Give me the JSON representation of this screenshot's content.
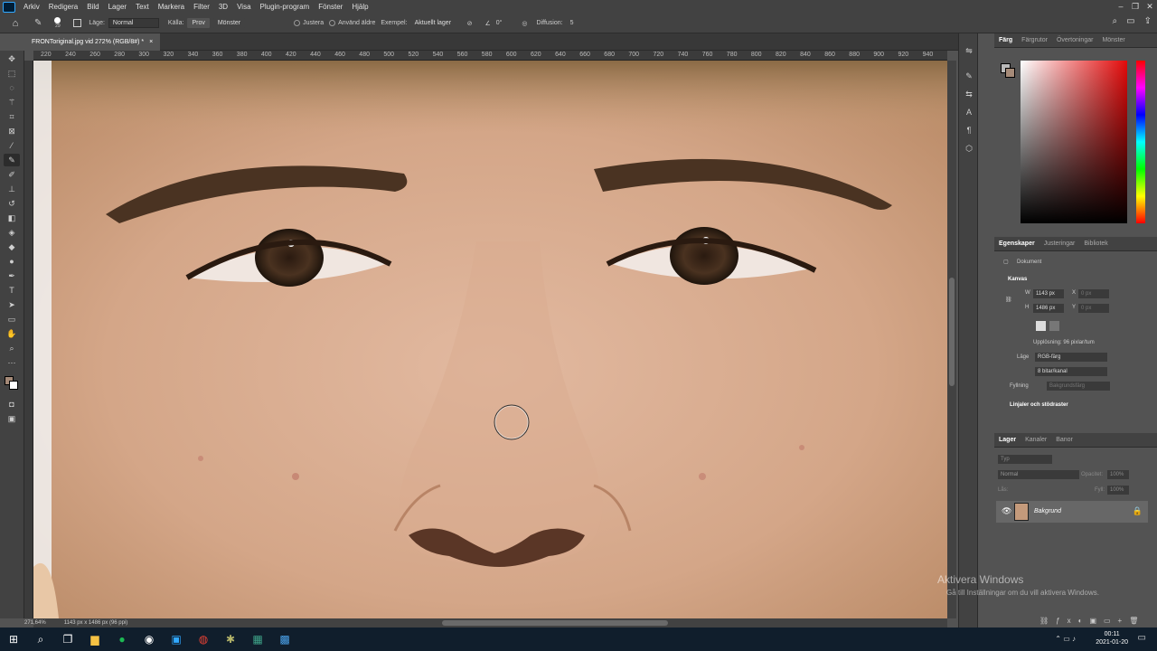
{
  "menu": [
    "Arkiv",
    "Redigera",
    "Bild",
    "Lager",
    "Text",
    "Markera",
    "Filter",
    "3D",
    "Visa",
    "Plugin-program",
    "Fönster",
    "Hjälp"
  ],
  "options": {
    "brush_size": "29",
    "mode_label": "Läge:",
    "mode_value": "Normal",
    "source_label": "Källa:",
    "source_btn1": "Prov",
    "source_btn2": "Mönster",
    "align_label": "Justera",
    "use_old_label": "Använd äldre",
    "sample_label": "Exempel:",
    "sample_value": "Aktuellt lager",
    "angle_value": "0°",
    "diffusion_label": "Diffusion:",
    "diffusion_value": "5"
  },
  "document_tab": {
    "title": "FRONToriginal.jpg vid 272% (RGB/8#) *",
    "close": "×"
  },
  "ruler_ticks": [
    "220",
    "240",
    "260",
    "280",
    "300",
    "320",
    "340",
    "360",
    "380",
    "400",
    "420",
    "440",
    "460",
    "480",
    "500",
    "520",
    "540",
    "560",
    "580",
    "600",
    "620",
    "640",
    "660",
    "680",
    "700",
    "720",
    "740",
    "760",
    "780",
    "800",
    "820",
    "840",
    "860",
    "880",
    "900",
    "920",
    "940"
  ],
  "status": {
    "zoom": "271,64%",
    "size": "1143 px x 1486 px (96 ppi)"
  },
  "color_panel": {
    "tabs": [
      "Färg",
      "Färgrutor",
      "Övertoningar",
      "Mönster"
    ],
    "active": "Färg"
  },
  "properties_panel": {
    "tabs": [
      "Egenskaper",
      "Justeringar",
      "Bibliotek"
    ],
    "doc_label": "Dokument",
    "canvas_section": "Kanvas",
    "w_label": "W",
    "w_value": "1143 px",
    "x_label": "X",
    "x_value": "0 px",
    "h_label": "H",
    "h_value": "1486 px",
    "y_label": "Y",
    "y_value": "0 px",
    "resolution": "Upplösning: 96 pixlar/tum",
    "mode_label": "Läge",
    "mode_value": "RGB-färg",
    "bits_value": "8 bitar/kanal",
    "fill_label": "Fyllning",
    "fill_value": "Bakgrundsfärg",
    "rulers_section": "Linjaler och stödraster"
  },
  "layers_panel": {
    "tabs": [
      "Lager",
      "Kanaler",
      "Banor"
    ],
    "search": "Typ",
    "blend": "Normal",
    "opacity_label": "Opacitet:",
    "opacity_value": "100%",
    "lock_label": "Lås:",
    "fill_label": "Fyll:",
    "fill_value": "100%",
    "layer_name": "Bakgrund"
  },
  "watermark": {
    "title": "Aktivera Windows",
    "subtitle": "Gå till Inställningar om du vill aktivera Windows."
  },
  "clock": {
    "time": "00:11",
    "date": "2021-01-20"
  },
  "colors": {
    "accent": "#31a8ff",
    "ui_dark": "#424242",
    "ui_mid": "#535353",
    "taskbar": "#101e2c"
  }
}
